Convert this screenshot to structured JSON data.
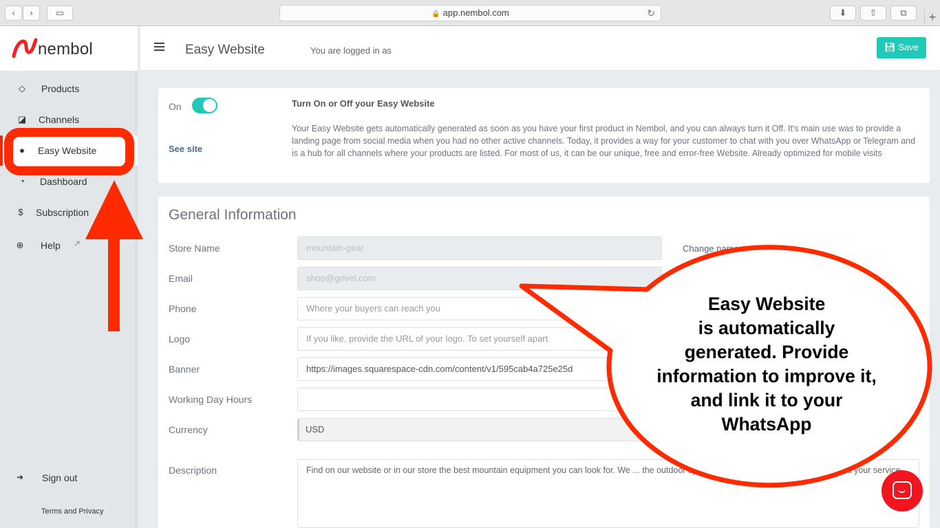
{
  "browser": {
    "url": "app.nembol.com"
  },
  "sidebar": {
    "logo_text": "nembol",
    "items": [
      {
        "label": "Products",
        "icon": "diamond-icon"
      },
      {
        "label": "Channels",
        "icon": "share-icon"
      },
      {
        "label": "Easy Website",
        "icon": "user-icon"
      },
      {
        "label": "Dashboard",
        "icon": "dashboard-icon"
      },
      {
        "label": "Subscription",
        "icon": "dollar-icon"
      },
      {
        "label": "Help",
        "icon": "lifebuoy-icon"
      }
    ],
    "sign_out": "Sign out",
    "terms": "Terms and Privacy"
  },
  "header": {
    "title": "Easy Website",
    "logged_in": "You are logged in as",
    "save_label": "Save"
  },
  "status_card": {
    "toggle_label": "On",
    "toggle_on": true,
    "see_site": "See site",
    "title": "Turn On or Off your Easy Website",
    "description": "Your Easy Website gets automatically generated as soon as you have your first product in Nembol, and you can always turn it Off. It's main use was to provide a landing page from social media when you had no other active channels. Today, it provides a way for your customer to chat with you over WhatsApp or Telegram and is a hub for all channels where your products are listed. For most of us, it can be our unique, free and error-free Website. Already optimized for mobile visits"
  },
  "general": {
    "title": "General Information",
    "change_name": "Change name",
    "fields": {
      "store_name": {
        "label": "Store Name",
        "value": "mountain-gear"
      },
      "email": {
        "label": "Email",
        "value": "shop@grivel.com"
      },
      "phone": {
        "label": "Phone",
        "placeholder": "Where your buyers can reach you"
      },
      "logo": {
        "label": "Logo",
        "placeholder": "If you like, provide the URL of your logo. To set yourself apart"
      },
      "banner": {
        "label": "Banner",
        "value": "https://images.squarespace-cdn.com/content/v1/595cab4a725e25d"
      },
      "hours": {
        "label": "Working Day Hours",
        "value": ""
      },
      "currency": {
        "label": "Currency",
        "value": "USD"
      },
      "description": {
        "label": "Description",
        "value": "Find on our website or in our store the best mountain equipment you can look for. We ... the outdoor space since 1978, and our experience is at your service."
      }
    }
  },
  "annotation": {
    "lines": [
      "Easy Website",
      "is automatically",
      "generated. Provide",
      "information to improve it,",
      "and link it to your",
      "WhatsApp"
    ],
    "color": "#ff2a00"
  }
}
